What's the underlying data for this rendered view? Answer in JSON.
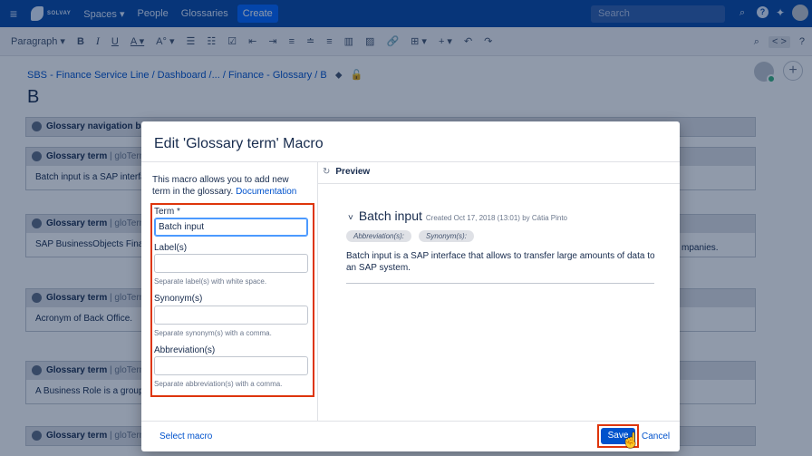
{
  "topnav": {
    "logo_text": "SOLVAY",
    "items": [
      "Spaces ▾",
      "People",
      "Glossaries"
    ],
    "create_label": "Create",
    "search_placeholder": "Search"
  },
  "toolbar": {
    "paragraph": "Paragraph ▾",
    "bold": "B",
    "italic": "I",
    "underline": "U",
    "text_color": "A ▾",
    "more_format": "A° ▾",
    "bullet_list": "☰",
    "number_list": "☷",
    "task_list": "☑",
    "outdent": "⇤",
    "indent": "⇥",
    "align_left": "≡",
    "align_center": "≐",
    "align_right": "≡",
    "layout": "▥",
    "image": "▨",
    "link": "🔗",
    "table": "⊞ ▾",
    "insert": "+ ▾",
    "undo": "↶",
    "redo": "↷",
    "find": "⌕",
    "source": "< >",
    "help": "?"
  },
  "page": {
    "breadcrumb": "SBS - Finance Service Line / Dashboard /... / Finance - Glossary / B",
    "title": "B",
    "macros": [
      {
        "name": "Glossary navigation bar",
        "sub": "",
        "body": ""
      },
      {
        "name": "Glossary term",
        "sub": " | gloTerm",
        "body": "Batch input is a SAP interfa"
      },
      {
        "name": "Glossary term",
        "sub": " | gloTerm",
        "body": "SAP BusinessObjects Financ"
      },
      {
        "name": "Glossary term",
        "sub": " | gloTerm",
        "body": "Acronym of Back Office."
      },
      {
        "name": "Glossary term",
        "sub": " | gloTerm",
        "body": "A Business Role is a group"
      },
      {
        "name": "Glossary term",
        "sub": " | gloTerm",
        "body": ""
      }
    ],
    "side_text": "mpanies."
  },
  "dialog": {
    "title": "Edit 'Glossary term' Macro",
    "intro": "This macro allows you to add new term in the glossary.",
    "doc_link": "Documentation",
    "fields": {
      "term_label": "Term *",
      "term_value": "Batch input",
      "labels_label": "Label(s)",
      "labels_value": "",
      "labels_hint": "Separate label(s) with white space.",
      "synonyms_label": "Synonym(s)",
      "synonyms_value": "",
      "synonyms_hint": "Separate synonym(s) with a comma.",
      "abbrev_label": "Abbreviation(s)",
      "abbrev_value": "",
      "abbrev_hint": "Separate abbreviation(s) with a comma."
    },
    "preview": {
      "header": "Preview",
      "term": "Batch input",
      "meta": "Created Oct 17, 2018 (13:01) by Cátia Pinto",
      "tags": [
        "Abbreviation(s):",
        "Synonym(s):"
      ],
      "description": "Batch input is a SAP interface that allows to transfer large amounts of data to an SAP system."
    },
    "select_macro": "Select macro",
    "save_label": "Save",
    "cancel_label": "Cancel"
  }
}
